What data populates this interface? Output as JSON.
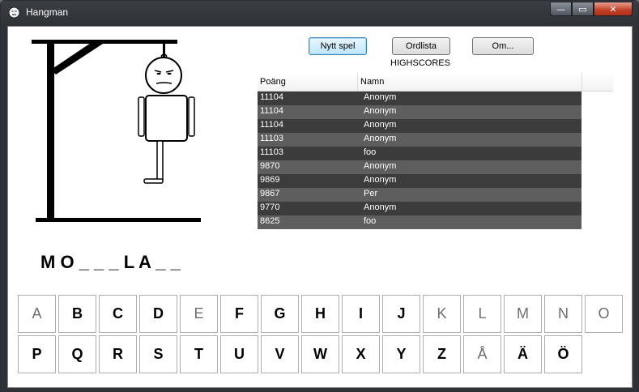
{
  "window": {
    "title": "Hangman",
    "min_glyph": "—",
    "max_glyph": "▭",
    "close_glyph": "✕"
  },
  "toolbar": {
    "new_game": "Nytt spel",
    "wordlist": "Ordlista",
    "about": "Om..."
  },
  "highscores": {
    "title": "HIGHSCORES",
    "columns": [
      "Poäng",
      "Namn"
    ],
    "rows": [
      {
        "score": "11104",
        "name": "Anonym"
      },
      {
        "score": "11104",
        "name": "Anonym"
      },
      {
        "score": "11104",
        "name": "Anonym"
      },
      {
        "score": "11103",
        "name": "Anonym"
      },
      {
        "score": "11103",
        "name": "foo"
      },
      {
        "score": "9870",
        "name": "Anonym"
      },
      {
        "score": "9869",
        "name": "Anonym"
      },
      {
        "score": "9867",
        "name": "Per"
      },
      {
        "score": "9770",
        "name": "Anonym"
      },
      {
        "score": "8625",
        "name": "foo"
      }
    ]
  },
  "game": {
    "word_display": "M O _ _ _ L A _ _"
  },
  "keyboard": {
    "row1": [
      {
        "letter": "A",
        "used": true
      },
      {
        "letter": "B",
        "used": false
      },
      {
        "letter": "C",
        "used": false
      },
      {
        "letter": "D",
        "used": false
      },
      {
        "letter": "E",
        "used": true
      },
      {
        "letter": "F",
        "used": false
      },
      {
        "letter": "G",
        "used": false
      },
      {
        "letter": "H",
        "used": false
      },
      {
        "letter": "I",
        "used": false
      },
      {
        "letter": "J",
        "used": false
      },
      {
        "letter": "K",
        "used": true
      },
      {
        "letter": "L",
        "used": true
      },
      {
        "letter": "M",
        "used": true
      },
      {
        "letter": "N",
        "used": true
      },
      {
        "letter": "O",
        "used": true
      }
    ],
    "row2": [
      {
        "letter": "P",
        "used": false
      },
      {
        "letter": "Q",
        "used": false
      },
      {
        "letter": "R",
        "used": false
      },
      {
        "letter": "S",
        "used": false
      },
      {
        "letter": "T",
        "used": false
      },
      {
        "letter": "U",
        "used": false
      },
      {
        "letter": "V",
        "used": false
      },
      {
        "letter": "W",
        "used": false
      },
      {
        "letter": "X",
        "used": false
      },
      {
        "letter": "Y",
        "used": false
      },
      {
        "letter": "Z",
        "used": false
      },
      {
        "letter": "Å",
        "used": true
      },
      {
        "letter": "Ä",
        "used": false
      },
      {
        "letter": "Ö",
        "used": false
      }
    ]
  }
}
